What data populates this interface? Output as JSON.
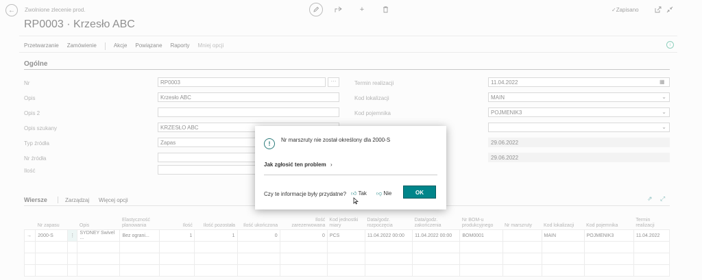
{
  "header": {
    "breadcrumb": "Zwolnione zlecenie prod.",
    "title": "RP0003 · Krzesło ABC",
    "saved": "✓Zapisano"
  },
  "actions": {
    "items": [
      "Przetwarzanie",
      "Zamówienie",
      "Akcje",
      "Powiązane",
      "Raporty",
      "Mniej opcji"
    ]
  },
  "general": {
    "title": "Ogólne",
    "left": [
      {
        "label": "Nr",
        "value": "RP0003"
      },
      {
        "label": "Opis",
        "value": "Krzesło ABC"
      },
      {
        "label": "Opis 2",
        "value": ""
      },
      {
        "label": "Opis szukany",
        "value": "KRZESŁO ABC"
      },
      {
        "label": "Typ źródła",
        "value": "Zapas"
      },
      {
        "label": "Nr źródła",
        "value": ""
      },
      {
        "label": "Ilość",
        "value": ""
      }
    ],
    "right": [
      {
        "label": "Termin realizacji",
        "value": "11.04.2022"
      },
      {
        "label": "Kod lokalizacji",
        "value": "MAIN"
      },
      {
        "label": "Kod pojemnika",
        "value": "POJMENIK3"
      },
      {
        "label": "",
        "value": ""
      },
      {
        "label": "",
        "value": "29.06.2022"
      },
      {
        "label": "",
        "value": "29.06.2022"
      }
    ]
  },
  "lines": {
    "title": "Wiersze",
    "manage": "Zarządzaj",
    "more": "Więcej opcji",
    "columns": [
      "Nr zapasu",
      "Opis",
      "Elastyczność planowania",
      "Ilość",
      "Ilość pozostała",
      "Ilość ukończona",
      "Ilość zarezerwowana",
      "Kod jednostki miary",
      "Data/godz. rozpoczęcia",
      "Data/godz. zakończenia",
      "Nr BOM-u produkcyjnego",
      "Nr marszruty",
      "Kod lokalizacji",
      "Kod pojemnika",
      "Termin realizacji"
    ],
    "rows": [
      [
        "2000-S",
        "SYDNEY Swivel ...",
        "Bez ograni...",
        "1",
        "1",
        "0",
        "0",
        "PCS",
        "11.04.2022 00:00",
        "11.04.2022 00:00",
        "BOM0001",
        "",
        "MAIN",
        "POJMENIK3",
        "11.04.2022"
      ]
    ]
  },
  "dialog": {
    "message": "Nr marszruty nie został określony dla 2000-S",
    "report_link": "Jak zgłosić ten problem",
    "question": "Czy te informacje były przydatne?",
    "yes": "Tak",
    "no": "Nie",
    "ok": "OK"
  }
}
